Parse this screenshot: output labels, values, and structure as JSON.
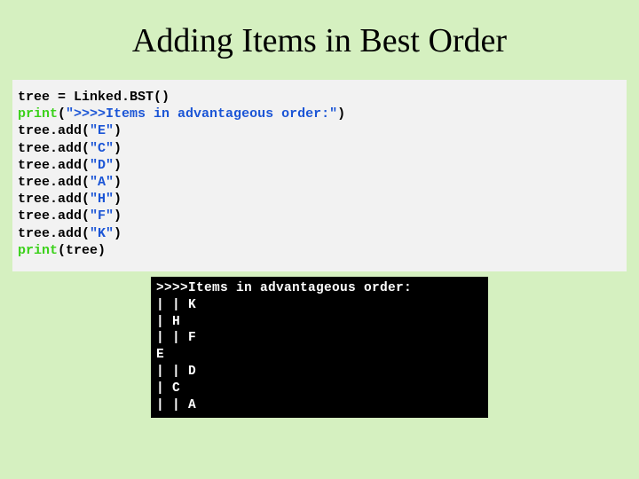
{
  "title": "Adding Items in Best Order",
  "code": {
    "l1_a": "tree = Linked.BST()",
    "l2_a": "print",
    "l2_b": "(",
    "l2_c": "\">>>>Items in advantageous order:\"",
    "l2_d": ")",
    "l3_a": "tree.add(",
    "l3_b": "\"E\"",
    "l3_c": ")",
    "l4_a": "tree.add(",
    "l4_b": "\"C\"",
    "l4_c": ")",
    "l5_a": "tree.add(",
    "l5_b": "\"D\"",
    "l5_c": ")",
    "l6_a": "tree.add(",
    "l6_b": "\"A\"",
    "l6_c": ")",
    "l7_a": "tree.add(",
    "l7_b": "\"H\"",
    "l7_c": ")",
    "l8_a": "tree.add(",
    "l8_b": "\"F\"",
    "l8_c": ")",
    "l9_a": "tree.add(",
    "l9_b": "\"K\"",
    "l9_c": ")",
    "l10_a": "print",
    "l10_b": "(tree)"
  },
  "output": {
    "o1": ">>>>Items in advantageous order:",
    "o2": "| | K",
    "o3": "| H",
    "o4": "| | F",
    "o5": "E",
    "o6": "| | D",
    "o7": "| C",
    "o8": "| | A"
  }
}
